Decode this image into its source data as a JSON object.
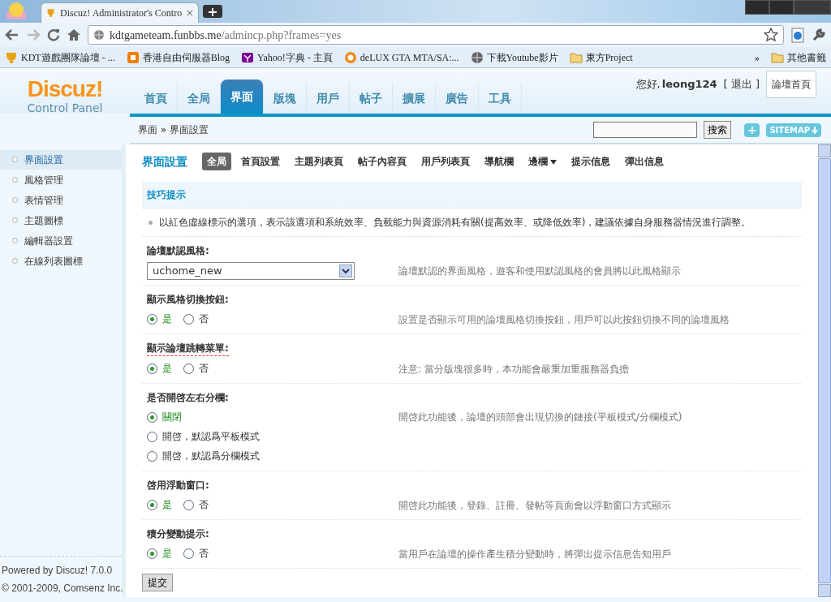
{
  "browser": {
    "tab_title": "Discuz! Administrator's Contro",
    "url_host": "kdtgameteam.funbbs.me",
    "url_path": "/admincp.php?frames=yes",
    "bookmarks": [
      {
        "label": "KDT遊戲團隊論壇 - ...",
        "kind": "trophy"
      },
      {
        "label": "香港自由伺服器Blog",
        "kind": "blogger"
      },
      {
        "label": "Yahoo!字典 - 主頁",
        "kind": "yahoo"
      },
      {
        "label": "deLUX GTA MTA/SA:...",
        "kind": "firefox"
      },
      {
        "label": "下載Youtube影片",
        "kind": "globe"
      },
      {
        "label": "東方Project",
        "kind": "folder"
      }
    ],
    "overflow": "»",
    "other_bookmarks": "其他書籤"
  },
  "header": {
    "logo_title": "Discuz!",
    "logo_subtitle": "Control Panel",
    "nav": [
      {
        "label": "首頁",
        "selected": false
      },
      {
        "label": "全局",
        "selected": false
      },
      {
        "label": "界面",
        "selected": true
      },
      {
        "label": "版塊",
        "selected": false
      },
      {
        "label": "用戶",
        "selected": false
      },
      {
        "label": "帖子",
        "selected": false
      },
      {
        "label": "擴展",
        "selected": false
      },
      {
        "label": "廣告",
        "selected": false
      },
      {
        "label": "工具",
        "selected": false
      }
    ],
    "greeting": "您好,",
    "username": "leong124",
    "logout": "[ 退出 ]",
    "forum_home": "論壇首頁"
  },
  "breadcrumb": "界面 » 界面設置",
  "search_button": "搜索",
  "add_button": "+",
  "sitemap_button": "SITEMAP",
  "sidebar": {
    "items": [
      {
        "label": "界面設置",
        "selected": true
      },
      {
        "label": "風格管理",
        "selected": false
      },
      {
        "label": "表情管理",
        "selected": false
      },
      {
        "label": "主題圖標",
        "selected": false
      },
      {
        "label": "編輯器設置",
        "selected": false
      },
      {
        "label": "在線列表圖標",
        "selected": false
      }
    ],
    "footer": {
      "powered": "Powered by",
      "product": "Discuz!",
      "version": "7.0.0",
      "copyright": "© 2001-2009,",
      "company": "Comsenz Inc."
    }
  },
  "main": {
    "title": "界面設置",
    "subtabs": [
      {
        "label": "全局",
        "selected": true,
        "kind": "tab"
      },
      {
        "label": "首頁設置",
        "selected": false,
        "kind": "tab"
      },
      {
        "label": "主題列表頁",
        "selected": false,
        "kind": "tab"
      },
      {
        "label": "帖子內容頁",
        "selected": false,
        "kind": "tab"
      },
      {
        "label": "用戶列表頁",
        "selected": false,
        "kind": "tab"
      },
      {
        "label": "導航欄",
        "selected": false,
        "kind": "tab"
      },
      {
        "label": "邊欄",
        "selected": false,
        "kind": "dropdown"
      },
      {
        "label": "提示信息",
        "selected": false,
        "kind": "tab"
      },
      {
        "label": "彈出信息",
        "selected": false,
        "kind": "tab"
      }
    ],
    "tips_title": "技巧提示",
    "tip": "以紅色虛線標示的選項，表示該選項和系統效率、負載能力與資源消耗有關(提高效率、或降低效率)，建議依據自身服務器情況進行調整。",
    "settings": [
      {
        "label": "論壇默認風格:",
        "flagged": false,
        "kind": "select",
        "value": "uchome_new",
        "description": "論壇默認的界面風格，遊客和使用默認風格的會員將以此風格顯示"
      },
      {
        "label": "顯示風格切換按鈕:",
        "flagged": false,
        "kind": "radio",
        "options": [
          {
            "label": "是",
            "selected": true
          },
          {
            "label": "否",
            "selected": false
          }
        ],
        "description": "設置是否顯示可用的論壇風格切換按鈕，用戶可以此按鈕切換不同的論壇風格"
      },
      {
        "label": "顯示論壇跳轉菜單:",
        "flagged": true,
        "kind": "radio",
        "options": [
          {
            "label": "是",
            "selected": true
          },
          {
            "label": "否",
            "selected": false
          }
        ],
        "description": "注意: 當分版塊很多時，本功能會嚴重加重服務器負擔"
      },
      {
        "label": "是否開啓左右分欄:",
        "flagged": false,
        "kind": "radio-list",
        "options": [
          {
            "label": "關閉",
            "selected": true
          },
          {
            "label": "開啓，默認爲平板模式",
            "selected": false
          },
          {
            "label": "開啓，默認爲分欄模式",
            "selected": false
          }
        ],
        "description": "開啓此功能後，論壇的頭部會出現切換的鏈接(平板模式/分欄模式)"
      },
      {
        "label": "啓用浮動窗口:",
        "flagged": false,
        "kind": "radio",
        "options": [
          {
            "label": "是",
            "selected": true
          },
          {
            "label": "否",
            "selected": false
          }
        ],
        "description": "開啓此功能後，登錄、註冊、發帖等頁面會以浮動窗口方式顯示"
      },
      {
        "label": "積分變動提示:",
        "flagged": false,
        "kind": "radio",
        "options": [
          {
            "label": "是",
            "selected": true
          },
          {
            "label": "否",
            "selected": false
          }
        ],
        "description": "當用戶在論壇的操作產生積分變動時，將彈出提示信息告知用戶"
      }
    ],
    "submit": "提交"
  }
}
